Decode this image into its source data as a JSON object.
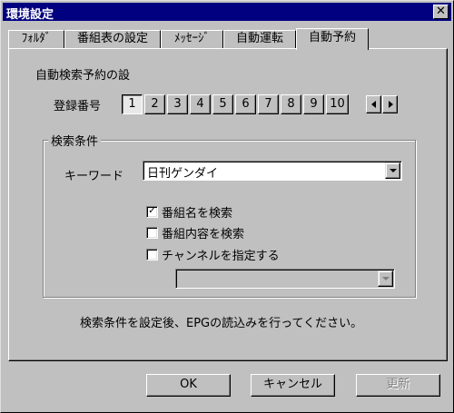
{
  "window": {
    "title": "環境設定"
  },
  "tabs": [
    {
      "label": "ﾌｫﾙﾀﾞ"
    },
    {
      "label": "番組表の設定"
    },
    {
      "label": "ﾒｯｾｰｼﾞ"
    },
    {
      "label": "自動運転"
    },
    {
      "label": "自動予約",
      "active": true
    }
  ],
  "panel": {
    "heading": "自動検索予約の設",
    "register_label": "登録番号",
    "numbers": [
      "1",
      "2",
      "3",
      "4",
      "5",
      "6",
      "7",
      "8",
      "9",
      "10"
    ],
    "selected_number": "1",
    "search_group": {
      "label": "検索条件",
      "keyword_label": "キーワード",
      "keyword_value": "日刊ゲンダイ",
      "checkboxes": [
        {
          "label": "番組名を検索",
          "checked": true,
          "mark": "✓"
        },
        {
          "label": "番組内容を検索",
          "checked": false,
          "mark": ""
        },
        {
          "label": "チャンネルを指定する",
          "checked": false,
          "mark": ""
        }
      ],
      "channel_value": ""
    },
    "note": "検索条件を設定後、EPGの読込みを行ってください。"
  },
  "buttons": {
    "ok": "OK",
    "cancel": "キャンセル",
    "update": "更新"
  },
  "icons": {
    "close": "close-icon",
    "prev": "arrow-left-icon",
    "next": "arrow-right-icon",
    "dropdown": "chevron-down-icon"
  }
}
